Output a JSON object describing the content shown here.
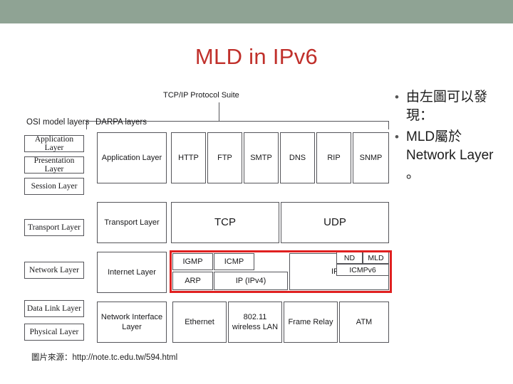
{
  "slide": {
    "title": "MLD in IPv6",
    "source_note": "圖片來源：http://note.tc.edu.tw/594.html",
    "accent_color": "#c0302b",
    "band_color": "#8fa394",
    "highlight_color": "#e02020"
  },
  "bullets": [
    {
      "marker": "•",
      "text": "由左圖可以發現："
    },
    {
      "marker": "•",
      "text": "MLD屬於 Network Layer 。"
    }
  ],
  "figure": {
    "suite_label": "TCP/IP Protocol Suite",
    "column_headers": {
      "osi": "OSI model layers",
      "darpa": "DARPA layers"
    },
    "osi_layers": [
      "Application Layer",
      "Presentation Layer",
      "Session Layer",
      "Transport Layer",
      "Network Layer",
      "Data Link Layer",
      "Physical Layer"
    ],
    "darpa_layers": [
      "Application Layer",
      "Transport Layer",
      "Internet Layer",
      "Network Interface Layer"
    ],
    "application_protocols": [
      "HTTP",
      "FTP",
      "SMTP",
      "DNS",
      "RIP",
      "SNMP"
    ],
    "transport_protocols": [
      "TCP",
      "UDP"
    ],
    "internet_protocols": {
      "igmp": "IGMP",
      "icmp": "ICMP",
      "arp": "ARP",
      "ipv4": "IP (IPv4)",
      "ipv6": "IPv6",
      "nd": "ND",
      "mld": "MLD",
      "icmpv6": "ICMPv6"
    },
    "network_interface_protocols": [
      "Ethernet",
      "802.11 wireless LAN",
      "Frame Relay",
      "ATM"
    ]
  }
}
